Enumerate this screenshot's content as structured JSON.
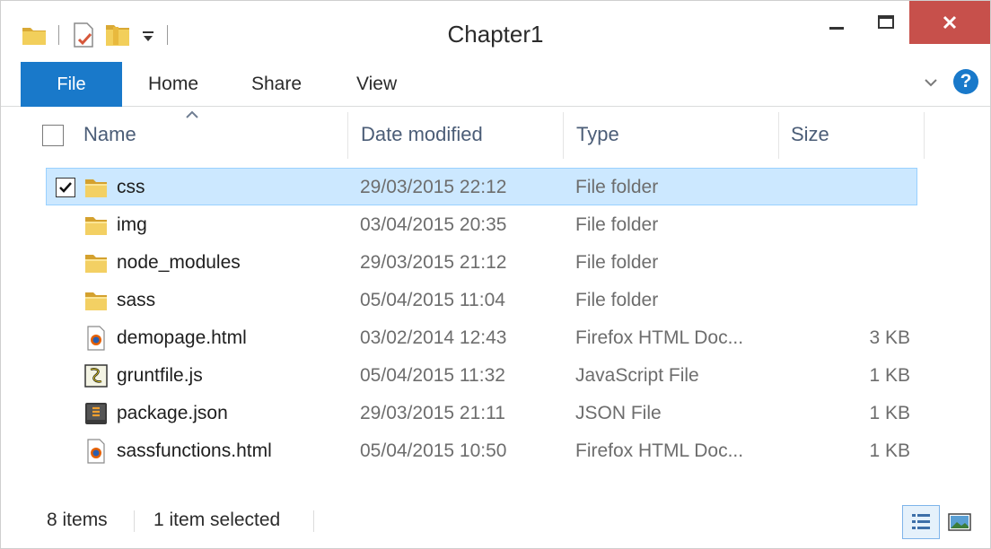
{
  "window": {
    "title": "Chapter1"
  },
  "icons": {
    "qat": [
      "folder-icon",
      "properties-icon",
      "new-folder-icon",
      "customize-dropdown-icon"
    ],
    "minimize": "minimize-icon",
    "maximize": "maximize-icon",
    "close": "close-icon",
    "help": "help-icon"
  },
  "ribbon": {
    "tabs": [
      "File",
      "Home",
      "Share",
      "View"
    ],
    "help_glyph": "?"
  },
  "columns": {
    "name": "Name",
    "date": "Date modified",
    "type": "Type",
    "size": "Size",
    "sort_column": "Name",
    "sort_direction": "ascending"
  },
  "files": [
    {
      "name": "css",
      "date": "29/03/2015 22:12",
      "type": "File folder",
      "size": "",
      "icon": "folder-icon",
      "selected": true,
      "checked": true
    },
    {
      "name": "img",
      "date": "03/04/2015 20:35",
      "type": "File folder",
      "size": "",
      "icon": "folder-icon",
      "selected": false,
      "checked": false
    },
    {
      "name": "node_modules",
      "date": "29/03/2015 21:12",
      "type": "File folder",
      "size": "",
      "icon": "folder-icon",
      "selected": false,
      "checked": false
    },
    {
      "name": "sass",
      "date": "05/04/2015 11:04",
      "type": "File folder",
      "size": "",
      "icon": "folder-icon",
      "selected": false,
      "checked": false
    },
    {
      "name": "demopage.html",
      "date": "03/02/2014 12:43",
      "type": "Firefox HTML Doc...",
      "size": "3 KB",
      "icon": "firefox-html-icon",
      "selected": false,
      "checked": false
    },
    {
      "name": "gruntfile.js",
      "date": "05/04/2015 11:32",
      "type": "JavaScript File",
      "size": "1 KB",
      "icon": "javascript-file-icon",
      "selected": false,
      "checked": false
    },
    {
      "name": "package.json",
      "date": "29/03/2015 21:11",
      "type": "JSON File",
      "size": "1 KB",
      "icon": "sublime-json-icon",
      "selected": false,
      "checked": false
    },
    {
      "name": "sassfunctions.html",
      "date": "05/04/2015 10:50",
      "type": "Firefox HTML Doc...",
      "size": "1 KB",
      "icon": "firefox-html-icon",
      "selected": false,
      "checked": false
    }
  ],
  "status": {
    "item_count": "8 items",
    "selection": "1 item selected",
    "active_view": "details"
  },
  "colors": {
    "accent": "#1979ca",
    "close": "#c7504b",
    "selection_fill": "#cce8ff",
    "selection_border": "#99d1ff",
    "folder": "#e8c04b"
  }
}
